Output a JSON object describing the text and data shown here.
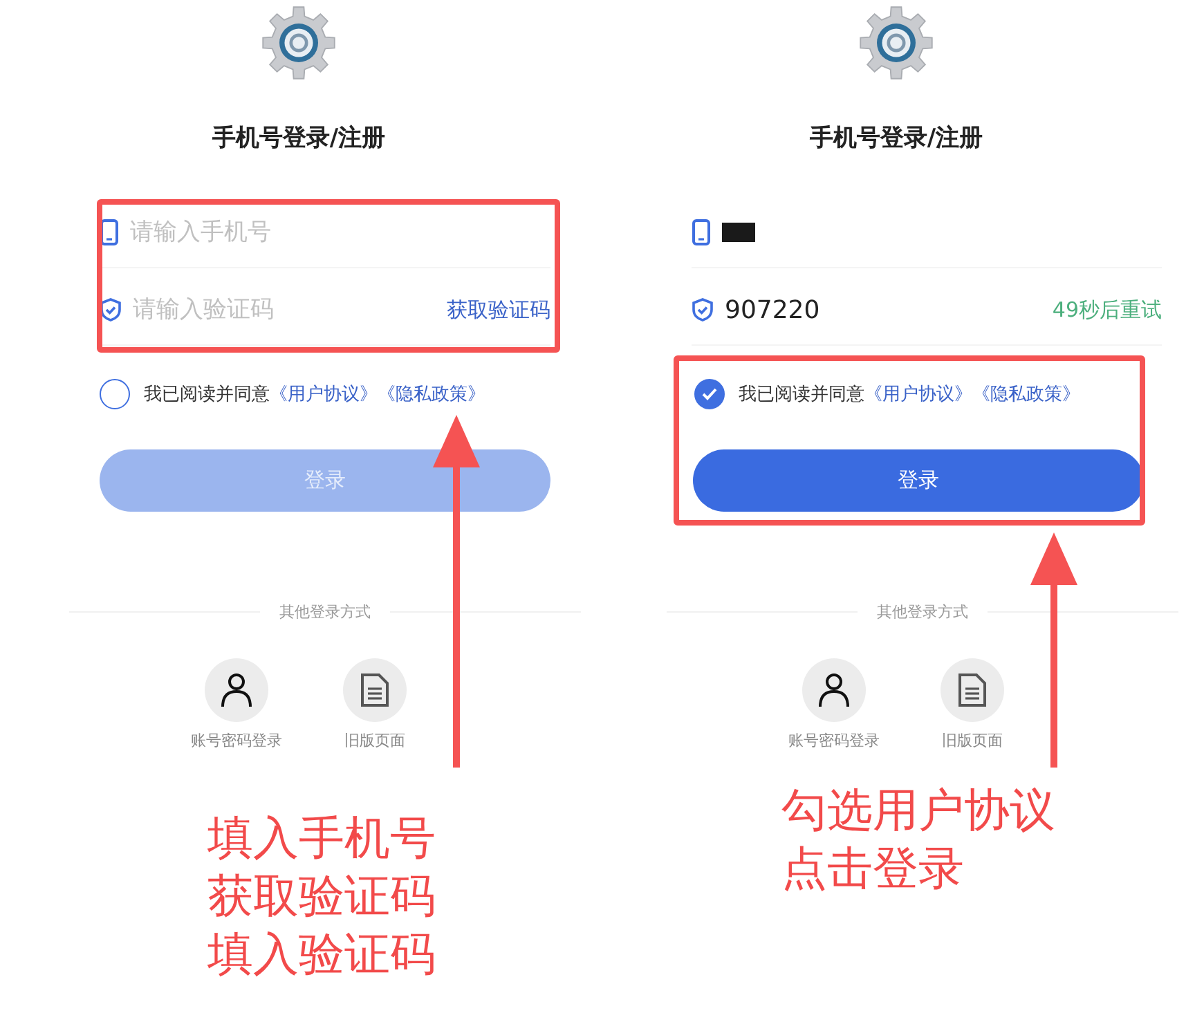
{
  "panels": [
    {
      "title": "手机号登录/注册",
      "phone": {
        "placeholder": "请输入手机号",
        "redacted": false
      },
      "code": {
        "placeholder": "请输入验证码"
      },
      "code_action": {
        "text": "获取验证码",
        "kind": "link"
      },
      "agreement": {
        "checked": false,
        "text": "我已阅读并同意",
        "links": [
          "《用户协议》",
          "《隐私政策》"
        ]
      },
      "login_button": {
        "label": "登录",
        "disabled": true
      },
      "other_login": {
        "label": "其他登录方式",
        "options": [
          {
            "label": "账号密码登录",
            "kind": "person"
          },
          {
            "label": "旧版页面",
            "kind": "document"
          }
        ]
      },
      "annotation": {
        "kind": "fields",
        "lines": [
          "填入手机号",
          "获取验证码",
          "填入验证码"
        ]
      }
    },
    {
      "title": "手机号登录/注册",
      "phone": {
        "redacted": true
      },
      "code": {
        "value": "907220"
      },
      "code_action": {
        "text": "49秒后重试",
        "kind": "countdown"
      },
      "agreement": {
        "checked": true,
        "text": "我已阅读并同意",
        "links": [
          "《用户协议》",
          "《隐私政策》"
        ]
      },
      "login_button": {
        "label": "登录",
        "disabled": false
      },
      "other_login": {
        "label": "其他登录方式",
        "options": [
          {
            "label": "账号密码登录",
            "kind": "person"
          },
          {
            "label": "旧版页面",
            "kind": "document"
          }
        ]
      },
      "annotation": {
        "kind": "agreement",
        "lines": [
          "勾选用户协议",
          "点击登录"
        ]
      }
    }
  ]
}
